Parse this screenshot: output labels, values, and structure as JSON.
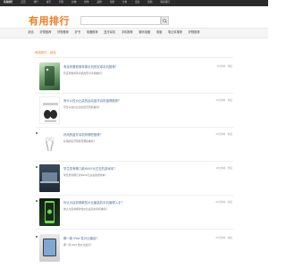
{
  "topbar": {
    "site": "有用排行",
    "links": [
      "首页",
      "排行",
      "资讯",
      "问答",
      "好物",
      "榜单",
      "品牌",
      "专题",
      "分类",
      "更多",
      "投稿",
      "联系我们"
    ]
  },
  "header": {
    "logo": "有用排行",
    "search_placeholder": "请输入您要搜索的关键词"
  },
  "nav": [
    "综合",
    "好物推荐",
    "好物推荐",
    "好书",
    "电器推荐",
    "蓝牙耳机",
    "手机推荐",
    "数码电器",
    "电脑",
    "笔记本推荐",
    "好物推荐"
  ],
  "breadcrumb": "有用排行 - 综合",
  "items": [
    {
      "title": "有没有看着像苹果手机的安卓手机推荐？",
      "subtitle": "有没有像苹果手机的安卓手机推荐？",
      "meta": "9分钟前 · 热度"
    },
    {
      "title": "有什么性价比高的运动蓝牙耳机值得推荐？",
      "subtitle": "有什么性价比高的蓝牙耳机推荐？",
      "meta": "12分钟前 · 热度"
    },
    {
      "title": "好用的蓝牙耳机有哪些推荐？",
      "subtitle": "好用的蓝牙耳机有哪些推荐？",
      "meta": "15分钟前 · 热度"
    },
    {
      "title": "学生党有哪几款6000元左右的游戏本？",
      "subtitle": "学生党有哪几款6000元左右的游戏本？",
      "meta": "18分钟前 · 热度"
    },
    {
      "title": "你认为目前哪款性价比最高的手机值得入手？",
      "subtitle": "你认为目前哪款性价比最高的手机推荐？",
      "meta": "22分钟前 · 热度"
    },
    {
      "title": "哪一款 iPad 性价比最高？",
      "subtitle": "哪一款 iPad 性价比最高？",
      "meta": "25分钟前 · 热度"
    }
  ],
  "colors": {
    "accent": "#f47a20",
    "link": "#4a6fa5",
    "topbar": "#2b2b2b"
  },
  "icons": [
    "search-icon"
  ]
}
